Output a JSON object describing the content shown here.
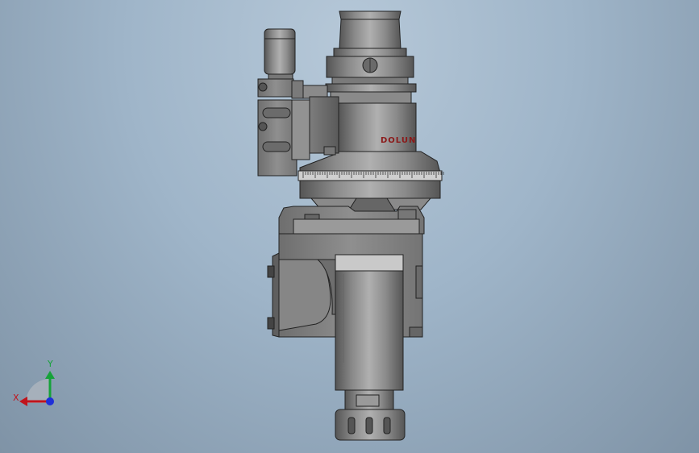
{
  "model": {
    "brand_text": "DOLUN",
    "colors": {
      "background_top": "#b6c8d8",
      "background_bottom": "#7f93a6",
      "metal": "#8d8d8d",
      "metal_light": "#b3b3b3",
      "metal_dark": "#5c5c5c",
      "outline": "#2a2a2a",
      "brand_red": "#8b1a1a"
    }
  },
  "triad": {
    "x_label": "X",
    "y_label": "Y",
    "x_color": "#c0141c",
    "y_color": "#16a23a",
    "z_color": "#1f2fd8"
  }
}
